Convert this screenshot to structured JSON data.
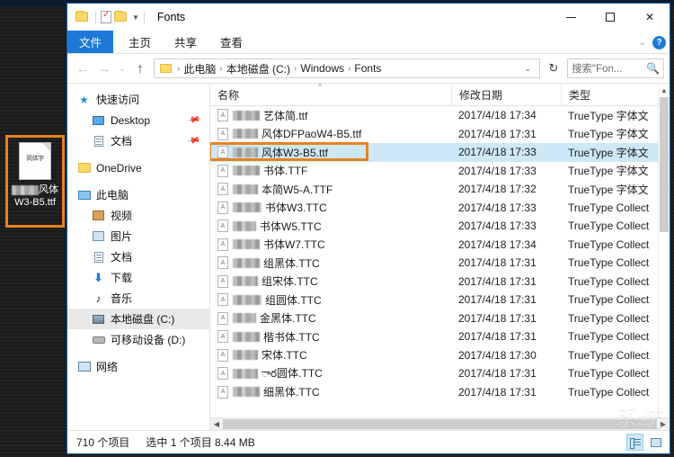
{
  "desktop": {
    "icon": {
      "preview_text": "简体字",
      "label_line1_suffix": "风体",
      "label_line2": "W3-B5.ttf",
      "name": "ttf-font-file"
    }
  },
  "window": {
    "title": "Fonts",
    "quick_access": [
      "folder-icon",
      "properties-icon",
      "new-folder-icon",
      "customize-caret"
    ],
    "controls": {
      "minimize": "—",
      "maximize": "□",
      "close": "✕"
    },
    "help_label": "?"
  },
  "ribbon": {
    "tabs": [
      {
        "label": "文件",
        "active": true
      },
      {
        "label": "主页",
        "active": false
      },
      {
        "label": "共享",
        "active": false
      },
      {
        "label": "查看",
        "active": false
      }
    ]
  },
  "address": {
    "back": "←",
    "forward": "→",
    "history": "⌄",
    "up": "↑",
    "breadcrumbs": [
      "此电脑",
      "本地磁盘 (C:)",
      "Windows",
      "Fonts"
    ],
    "separator": "›",
    "dropdown_caret": "⌄",
    "refresh": "↻"
  },
  "search": {
    "placeholder": "搜索\"Fon...",
    "icon": "search-icon"
  },
  "sidebar": {
    "items": [
      {
        "label": "快速访问",
        "icon": "star-icon",
        "indent": false,
        "pinned": false,
        "selected": false
      },
      {
        "label": "Desktop",
        "icon": "desktop-icon",
        "indent": true,
        "pinned": true,
        "selected": false
      },
      {
        "label": "文档",
        "icon": "document-icon",
        "indent": true,
        "pinned": true,
        "selected": false
      },
      {
        "label": "OneDrive",
        "icon": "onedrive-folder-icon",
        "indent": false,
        "pinned": false,
        "selected": false
      },
      {
        "label": "此电脑",
        "icon": "this-pc-icon",
        "indent": false,
        "pinned": false,
        "selected": false
      },
      {
        "label": "视频",
        "icon": "video-icon",
        "indent": true,
        "pinned": false,
        "selected": false
      },
      {
        "label": "图片",
        "icon": "picture-icon",
        "indent": true,
        "pinned": false,
        "selected": false
      },
      {
        "label": "文档",
        "icon": "document-icon",
        "indent": true,
        "pinned": false,
        "selected": false
      },
      {
        "label": "下载",
        "icon": "download-icon",
        "indent": true,
        "pinned": false,
        "selected": false
      },
      {
        "label": "音乐",
        "icon": "music-icon",
        "indent": true,
        "pinned": false,
        "selected": false
      },
      {
        "label": "本地磁盘 (C:)",
        "icon": "drive-icon",
        "indent": true,
        "pinned": false,
        "selected": true
      },
      {
        "label": "可移动设备 (D:)",
        "icon": "removable-drive-icon",
        "indent": true,
        "pinned": false,
        "selected": false
      },
      {
        "label": "网络",
        "icon": "network-icon",
        "indent": false,
        "pinned": false,
        "selected": false
      }
    ]
  },
  "filelist": {
    "columns": [
      "名称",
      "修改日期",
      "类型"
    ],
    "sort_indicator": "^",
    "rows": [
      {
        "name": "艺体简.ttf",
        "date": "2017/4/18 17:34",
        "type": "TrueType 字体文",
        "selected": false,
        "blur_w": 30
      },
      {
        "name": "风体DFPaoW4-B5.ttf",
        "date": "2017/4/18 17:31",
        "type": "TrueType 字体文",
        "selected": false,
        "blur_w": 28
      },
      {
        "name": "风体W3-B5.ttf",
        "date": "2017/4/18 17:33",
        "type": "TrueType 字体文",
        "selected": true,
        "blur_w": 28
      },
      {
        "name": "书体.TTF",
        "date": "2017/4/18 17:33",
        "type": "TrueType 字体文",
        "selected": false,
        "blur_w": 30
      },
      {
        "name": "本简W5-A.TTF",
        "date": "2017/4/18 17:32",
        "type": "TrueType 字体文",
        "selected": false,
        "blur_w": 28
      },
      {
        "name": "书体W3.TTC",
        "date": "2017/4/18 17:33",
        "type": "TrueType Collect",
        "selected": false,
        "blur_w": 32
      },
      {
        "name": "书体W5.TTC",
        "date": "2017/4/18 17:33",
        "type": "TrueType Collect",
        "selected": false,
        "blur_w": 26
      },
      {
        "name": "书体W7.TTC",
        "date": "2017/4/18 17:34",
        "type": "TrueType Collect",
        "selected": false,
        "blur_w": 30
      },
      {
        "name": "组黑体.TTC",
        "date": "2017/4/18 17:31",
        "type": "TrueType Collect",
        "selected": false,
        "blur_w": 30
      },
      {
        "name": "组宋体.TTC",
        "date": "2017/4/18 17:31",
        "type": "TrueType Collect",
        "selected": false,
        "blur_w": 28
      },
      {
        "name": "组圆体.TTC",
        "date": "2017/4/18 17:31",
        "type": "TrueType Collect",
        "selected": false,
        "blur_w": 32
      },
      {
        "name": "金黑体.TTC",
        "date": "2017/4/18 17:31",
        "type": "TrueType Collect",
        "selected": false,
        "blur_w": 26
      },
      {
        "name": "楷书体.TTC",
        "date": "2017/4/18 17:31",
        "type": "TrueType Collect",
        "selected": false,
        "blur_w": 30
      },
      {
        "name": "宋体.TTC",
        "date": "2017/4/18 17:30",
        "type": "TrueType Collect",
        "selected": false,
        "blur_w": 28
      },
      {
        "name": "ార圆体.TTC",
        "date": "2017/4/18 17:31",
        "type": "TrueType Collect",
        "selected": false,
        "blur_w": 28
      },
      {
        "name": "细黑体.TTC",
        "date": "2017/4/18 17:31",
        "type": "TrueType Collect",
        "selected": false,
        "blur_w": 30
      }
    ]
  },
  "statusbar": {
    "item_count": "710 个项目",
    "selection": "选中 1 个项目  8.44 MB",
    "view_details": "details-view-icon",
    "view_icons": "large-icons-view-icon"
  },
  "annotation": {
    "color": "#e8821e"
  },
  "watermark": {
    "text": "系统"
  }
}
